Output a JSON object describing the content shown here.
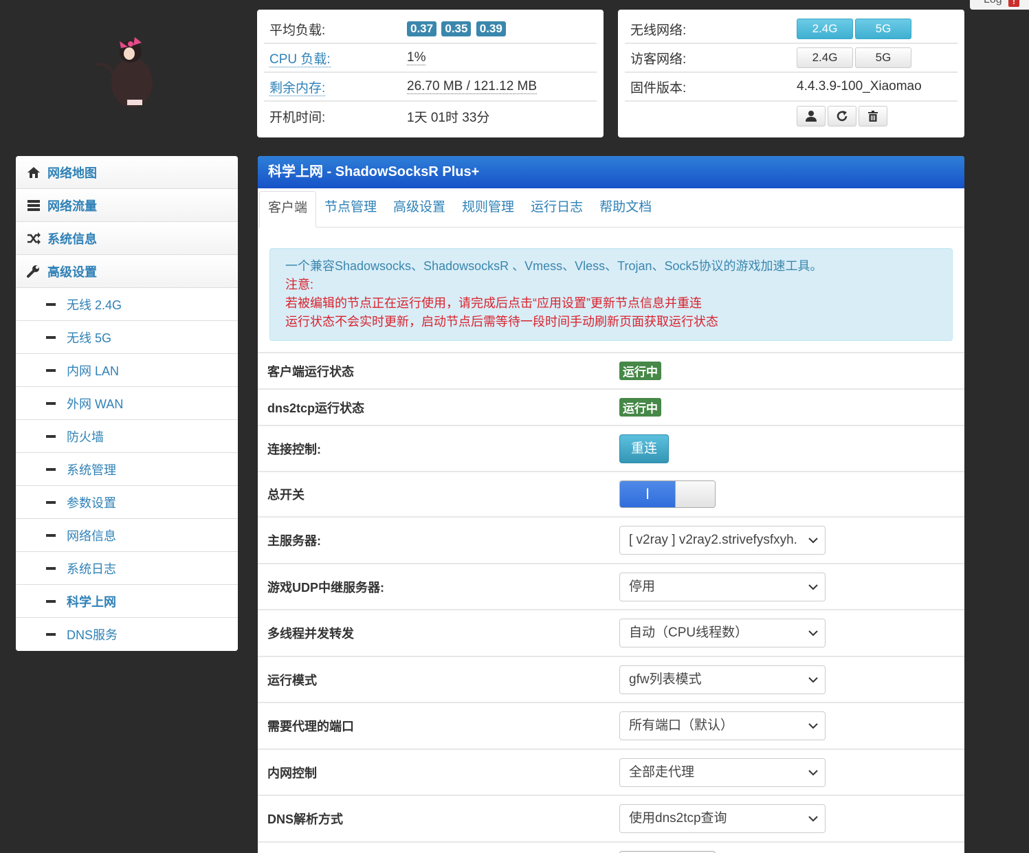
{
  "log_button": {
    "label": "Log",
    "alert": "!"
  },
  "status": {
    "load": {
      "label": "平均负载:",
      "values": [
        "0.37",
        "0.35",
        "0.39"
      ]
    },
    "cpu": {
      "label": "CPU 负载:",
      "value": "1%"
    },
    "memory": {
      "label": "剩余内存:",
      "value": "26.70 MB / 121.12 MB"
    },
    "uptime": {
      "label": "开机时间:",
      "value": "1天 01时 33分"
    }
  },
  "wireless": {
    "wifi": {
      "label": "无线网络:",
      "b24": "2.4G",
      "b5": "5G"
    },
    "guest": {
      "label": "访客网络:",
      "b24": "2.4G",
      "b5": "5G"
    },
    "firmware": {
      "label": "固件版本:",
      "value": "4.4.3.9-100_Xiaomao"
    }
  },
  "sidebar": {
    "top": [
      {
        "label": "网络地图",
        "icon": "home-icon"
      },
      {
        "label": "网络流量",
        "icon": "server-icon"
      },
      {
        "label": "系统信息",
        "icon": "shuffle-icon"
      },
      {
        "label": "高级设置",
        "icon": "wrench-icon"
      }
    ],
    "sub": [
      {
        "label": "无线 2.4G"
      },
      {
        "label": "无线 5G"
      },
      {
        "label": "内网 LAN"
      },
      {
        "label": "外网 WAN"
      },
      {
        "label": "防火墙"
      },
      {
        "label": "系统管理"
      },
      {
        "label": "参数设置"
      },
      {
        "label": "网络信息"
      },
      {
        "label": "系统日志"
      },
      {
        "label": "科学上网"
      },
      {
        "label": "DNS服务"
      }
    ]
  },
  "main": {
    "title": "科学上网 - ShadowSocksR Plus+",
    "tabs": [
      "客户端",
      "节点管理",
      "高级设置",
      "规则管理",
      "运行日志",
      "帮助文档"
    ],
    "alert": {
      "line1": "一个兼容Shadowsocks、ShadowsocksR 、Vmess、Vless、Trojan、Sock5协议的游戏加速工具。",
      "line2": "注意:",
      "line3": "若被编辑的节点正在运行使用，请完成后点击“应用设置”更新节点信息并重连",
      "line4": "运行状态不会实时更新，启动节点后需等待一段时间手动刷新页面获取运行状态"
    },
    "fields": {
      "client_status": {
        "label": "客户端运行状态",
        "value": "运行中"
      },
      "dns_status": {
        "label": "dns2tcp运行状态",
        "value": "运行中"
      },
      "connection": {
        "label": "连接控制:",
        "button": "重连"
      },
      "master": {
        "label": "总开关",
        "on_text": "I"
      },
      "server": {
        "label": "主服务器:",
        "value": "[ v2ray ] v2ray2.strivefysfxyh."
      },
      "udp": {
        "label": "游戏UDP中继服务器:",
        "value": "停用"
      },
      "threads": {
        "label": "多线程并发转发",
        "value": "自动（CPU线程数）"
      },
      "mode": {
        "label": "运行模式",
        "value": "gfw列表模式"
      },
      "ports": {
        "label": "需要代理的端口",
        "value": "所有端口（默认）"
      },
      "lan": {
        "label": "内网控制",
        "value": "全部走代理"
      },
      "dns": {
        "label": "DNS解析方式",
        "value": "使用dns2tcp查询"
      }
    }
  },
  "colors": {
    "link": "#2f81b7",
    "header": "#1f63d0",
    "running": "#468847",
    "info": "#5bc0de",
    "warn": "#d9232d"
  }
}
